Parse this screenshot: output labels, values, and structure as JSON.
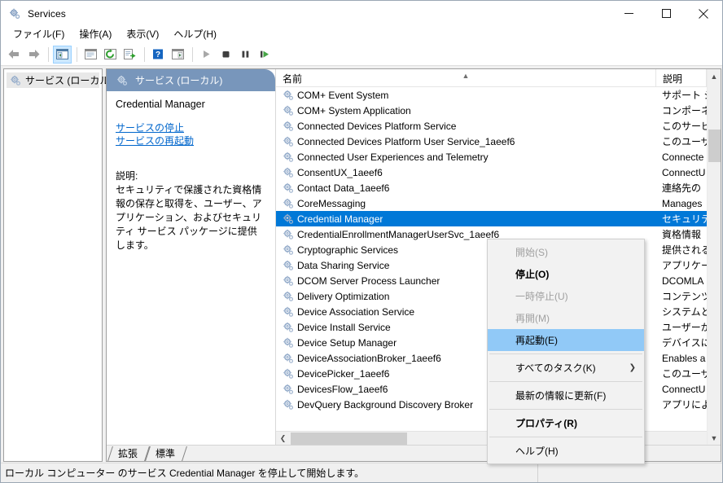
{
  "window": {
    "title": "Services",
    "icon": "services-gear-icon",
    "buttons": {
      "minimize": "—",
      "maximize": "□",
      "close": "×"
    }
  },
  "menubar": {
    "items": [
      {
        "label": "ファイル(F)",
        "name": "menu-file"
      },
      {
        "label": "操作(A)",
        "name": "menu-action"
      },
      {
        "label": "表示(V)",
        "name": "menu-view"
      },
      {
        "label": "ヘルプ(H)",
        "name": "menu-help"
      }
    ]
  },
  "toolbar": {
    "buttons": [
      {
        "name": "back-icon",
        "title": "戻る"
      },
      {
        "name": "forward-icon",
        "title": "進む"
      },
      {
        "name": "show-hide-tree-icon",
        "title": "コンソール ツリーの表示/非表示"
      },
      {
        "name": "properties-icon",
        "title": "プロパティ"
      },
      {
        "name": "refresh-icon",
        "title": "最新の情報に更新"
      },
      {
        "name": "export-list-icon",
        "title": "一覧のエクスポート"
      },
      {
        "name": "help-icon",
        "title": "ヘルプ"
      },
      {
        "name": "show-action-pane-icon",
        "title": "操作ウィンドウの表示"
      },
      {
        "name": "start-service-icon",
        "title": "サービスの開始"
      },
      {
        "name": "stop-service-icon",
        "title": "サービスの停止"
      },
      {
        "name": "pause-service-icon",
        "title": "サービスの一時停止"
      },
      {
        "name": "restart-service-icon",
        "title": "サービスの再起動"
      }
    ]
  },
  "tree": {
    "root_label": "サービス (ローカル)",
    "root_icon": "services-gear-icon"
  },
  "details": {
    "header_label": "サービス (ローカル)",
    "header_icon": "services-gear-icon",
    "service_name": "Credential Manager",
    "links": [
      {
        "label": "サービスの停止",
        "name": "stop-service-link"
      },
      {
        "label": "サービスの再起動",
        "name": "restart-service-link"
      }
    ],
    "description_label": "説明:",
    "description_text": "セキュリティで保護された資格情報の保存と取得を、ユーザー、アプリケーション、およびセキュリティ サービス パッケージに提供します。"
  },
  "list": {
    "columns": [
      {
        "label": "名前",
        "name": "column-name",
        "sort": "ascending"
      },
      {
        "label": "説明",
        "name": "column-description",
        "sort": "none"
      }
    ],
    "rows": [
      {
        "name": "COM+ Event System",
        "description": "サポート シ"
      },
      {
        "name": "COM+ System Application",
        "description": "コンポーネン"
      },
      {
        "name": "Connected Devices Platform Service",
        "description": "このサービ"
      },
      {
        "name": "Connected Devices Platform User Service_1aeef6",
        "description": "このユーザー"
      },
      {
        "name": "Connected User Experiences and Telemetry",
        "description": "Connecte"
      },
      {
        "name": "ConsentUX_1aeef6",
        "description": "ConnectU"
      },
      {
        "name": "Contact Data_1aeef6",
        "description": "連絡先の"
      },
      {
        "name": "CoreMessaging",
        "description": "Manages"
      },
      {
        "name": "Credential Manager",
        "description": "セキュリティ",
        "selected": true
      },
      {
        "name": "CredentialEnrollmentManagerUserSvc_1aeef6",
        "description": "資格情報"
      },
      {
        "name": "Cryptographic Services",
        "description": "提供される"
      },
      {
        "name": "Data Sharing Service",
        "description": "アプリケー"
      },
      {
        "name": "DCOM Server Process Launcher",
        "description": "DCOMLA"
      },
      {
        "name": "Delivery Optimization",
        "description": "コンテンツ配"
      },
      {
        "name": "Device Association Service",
        "description": "システムと"
      },
      {
        "name": "Device Install Service",
        "description": "ユーザーが"
      },
      {
        "name": "Device Setup Manager",
        "description": "デバイスに"
      },
      {
        "name": "DeviceAssociationBroker_1aeef6",
        "description": "Enables a"
      },
      {
        "name": "DevicePicker_1aeef6",
        "description": "このユーザー"
      },
      {
        "name": "DevicesFlow_1aeef6",
        "description": "ConnectU"
      },
      {
        "name": "DevQuery Background Discovery Broker",
        "description": "アプリによる"
      }
    ]
  },
  "context_menu": {
    "items": [
      {
        "label": "開始(S)",
        "name": "ctx-start",
        "state": "disabled"
      },
      {
        "label": "停止(O)",
        "name": "ctx-stop",
        "state": "bold"
      },
      {
        "label": "一時停止(U)",
        "name": "ctx-pause",
        "state": "disabled"
      },
      {
        "label": "再開(M)",
        "name": "ctx-resume",
        "state": "disabled"
      },
      {
        "label": "再起動(E)",
        "name": "ctx-restart",
        "state": "highlighted"
      },
      {
        "separator": true
      },
      {
        "label": "すべてのタスク(K)",
        "name": "ctx-all-tasks",
        "state": "normal",
        "submenu": true
      },
      {
        "separator": true
      },
      {
        "label": "最新の情報に更新(F)",
        "name": "ctx-refresh",
        "state": "normal"
      },
      {
        "separator": true
      },
      {
        "label": "プロパティ(R)",
        "name": "ctx-properties",
        "state": "bold"
      },
      {
        "separator": true
      },
      {
        "label": "ヘルプ(H)",
        "name": "ctx-help",
        "state": "normal"
      }
    ]
  },
  "tabs": [
    {
      "label": "拡張",
      "name": "tab-extended"
    },
    {
      "label": "標準",
      "name": "tab-standard"
    }
  ],
  "statusbar": {
    "text": "ローカル コンピューター のサービス Credential Manager を停止して開始します。"
  },
  "colors": {
    "selection_blue": "#0078d7",
    "details_header": "#7896bb",
    "menu_highlight": "#91c9f7",
    "link": "#0066cc"
  }
}
